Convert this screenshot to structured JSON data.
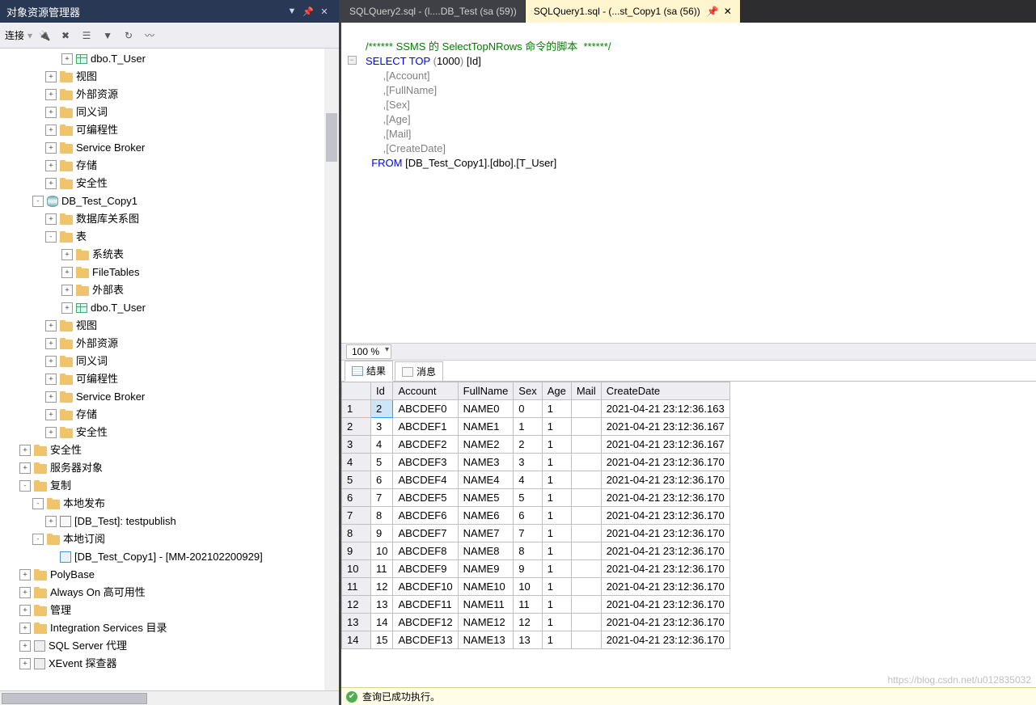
{
  "panel": {
    "title": "对象资源管理器"
  },
  "toolbar": {
    "connect_label": "连接",
    "icons": [
      "plug-icon",
      "plug-x-icon",
      "list-icon",
      "filter-icon",
      "refresh-icon",
      "activity-icon"
    ]
  },
  "tree": [
    {
      "d": 4,
      "exp": "+",
      "icon": "table",
      "label": "dbo.T_User"
    },
    {
      "d": 3,
      "exp": "+",
      "icon": "folder",
      "label": "视图"
    },
    {
      "d": 3,
      "exp": "+",
      "icon": "folder",
      "label": "外部资源"
    },
    {
      "d": 3,
      "exp": "+",
      "icon": "folder",
      "label": "同义词"
    },
    {
      "d": 3,
      "exp": "+",
      "icon": "folder",
      "label": "可编程性"
    },
    {
      "d": 3,
      "exp": "+",
      "icon": "folder",
      "label": "Service Broker"
    },
    {
      "d": 3,
      "exp": "+",
      "icon": "folder",
      "label": "存储"
    },
    {
      "d": 3,
      "exp": "+",
      "icon": "folder",
      "label": "安全性"
    },
    {
      "d": 2,
      "exp": "-",
      "icon": "db",
      "label": "DB_Test_Copy1"
    },
    {
      "d": 3,
      "exp": "+",
      "icon": "folder",
      "label": "数据库关系图"
    },
    {
      "d": 3,
      "exp": "-",
      "icon": "folder",
      "label": "表"
    },
    {
      "d": 4,
      "exp": "+",
      "icon": "folder",
      "label": "系统表"
    },
    {
      "d": 4,
      "exp": "+",
      "icon": "folder",
      "label": "FileTables"
    },
    {
      "d": 4,
      "exp": "+",
      "icon": "folder",
      "label": "外部表"
    },
    {
      "d": 4,
      "exp": "+",
      "icon": "table",
      "label": "dbo.T_User"
    },
    {
      "d": 3,
      "exp": "+",
      "icon": "folder",
      "label": "视图"
    },
    {
      "d": 3,
      "exp": "+",
      "icon": "folder",
      "label": "外部资源"
    },
    {
      "d": 3,
      "exp": "+",
      "icon": "folder",
      "label": "同义词"
    },
    {
      "d": 3,
      "exp": "+",
      "icon": "folder",
      "label": "可编程性"
    },
    {
      "d": 3,
      "exp": "+",
      "icon": "folder",
      "label": "Service Broker"
    },
    {
      "d": 3,
      "exp": "+",
      "icon": "folder",
      "label": "存储"
    },
    {
      "d": 3,
      "exp": "+",
      "icon": "folder",
      "label": "安全性"
    },
    {
      "d": 1,
      "exp": "+",
      "icon": "folder",
      "label": "安全性"
    },
    {
      "d": 1,
      "exp": "+",
      "icon": "folder",
      "label": "服务器对象"
    },
    {
      "d": 1,
      "exp": "-",
      "icon": "folder",
      "label": "复制"
    },
    {
      "d": 2,
      "exp": "-",
      "icon": "folder",
      "label": "本地发布"
    },
    {
      "d": 3,
      "exp": "+",
      "icon": "pub",
      "label": "[DB_Test]: testpublish"
    },
    {
      "d": 2,
      "exp": "-",
      "icon": "folder",
      "label": "本地订阅"
    },
    {
      "d": 3,
      "exp": "",
      "icon": "sub",
      "label": "[DB_Test_Copy1] - [MM-202102200929]"
    },
    {
      "d": 1,
      "exp": "+",
      "icon": "folder",
      "label": "PolyBase"
    },
    {
      "d": 1,
      "exp": "+",
      "icon": "folder",
      "label": "Always On 高可用性"
    },
    {
      "d": 1,
      "exp": "+",
      "icon": "folder",
      "label": "管理"
    },
    {
      "d": 1,
      "exp": "+",
      "icon": "folder",
      "label": "Integration Services 目录"
    },
    {
      "d": 1,
      "exp": "+",
      "icon": "misc",
      "label": "SQL Server 代理"
    },
    {
      "d": 1,
      "exp": "+",
      "icon": "misc",
      "label": "XEvent 探查器"
    }
  ],
  "tabs": [
    {
      "label": "SQLQuery2.sql - (l....DB_Test (sa (59))",
      "active": false
    },
    {
      "label": "SQLQuery1.sql - (...st_Copy1 (sa (56))",
      "active": true
    }
  ],
  "editor": {
    "comment": "/****** SSMS 的 SelectTopNRows 命令的脚本  ******/",
    "l1a": "SELECT",
    "l1b": " TOP ",
    "l1c": "(",
    "l1d": "1000",
    "l1e": ")",
    "l1f": " [Id]",
    "l2": "      ,[Account]",
    "l3": "      ,[FullName]",
    "l4": "      ,[Sex]",
    "l5": "      ,[Age]",
    "l6": "      ,[Mail]",
    "l7": "      ,[CreateDate]",
    "l8a": "  FROM ",
    "l8b": "[DB_Test_Copy1].[dbo].[T_User]"
  },
  "zoom": {
    "value": "100 %",
    "drop": "▾"
  },
  "result_tabs": {
    "results": "结果",
    "messages": "消息"
  },
  "columns": [
    "",
    "Id",
    "Account",
    "FullName",
    "Sex",
    "Age",
    "Mail",
    "CreateDate"
  ],
  "rows": [
    {
      "n": "1",
      "Id": "2",
      "Account": "ABCDEF0",
      "FullName": "NAME0",
      "Sex": "0",
      "Age": "1",
      "Mail": "",
      "CreateDate": "2021-04-21 23:12:36.163"
    },
    {
      "n": "2",
      "Id": "3",
      "Account": "ABCDEF1",
      "FullName": "NAME1",
      "Sex": "1",
      "Age": "1",
      "Mail": "",
      "CreateDate": "2021-04-21 23:12:36.167"
    },
    {
      "n": "3",
      "Id": "4",
      "Account": "ABCDEF2",
      "FullName": "NAME2",
      "Sex": "2",
      "Age": "1",
      "Mail": "",
      "CreateDate": "2021-04-21 23:12:36.167"
    },
    {
      "n": "4",
      "Id": "5",
      "Account": "ABCDEF3",
      "FullName": "NAME3",
      "Sex": "3",
      "Age": "1",
      "Mail": "",
      "CreateDate": "2021-04-21 23:12:36.170"
    },
    {
      "n": "5",
      "Id": "6",
      "Account": "ABCDEF4",
      "FullName": "NAME4",
      "Sex": "4",
      "Age": "1",
      "Mail": "",
      "CreateDate": "2021-04-21 23:12:36.170"
    },
    {
      "n": "6",
      "Id": "7",
      "Account": "ABCDEF5",
      "FullName": "NAME5",
      "Sex": "5",
      "Age": "1",
      "Mail": "",
      "CreateDate": "2021-04-21 23:12:36.170"
    },
    {
      "n": "7",
      "Id": "8",
      "Account": "ABCDEF6",
      "FullName": "NAME6",
      "Sex": "6",
      "Age": "1",
      "Mail": "",
      "CreateDate": "2021-04-21 23:12:36.170"
    },
    {
      "n": "8",
      "Id": "9",
      "Account": "ABCDEF7",
      "FullName": "NAME7",
      "Sex": "7",
      "Age": "1",
      "Mail": "",
      "CreateDate": "2021-04-21 23:12:36.170"
    },
    {
      "n": "9",
      "Id": "10",
      "Account": "ABCDEF8",
      "FullName": "NAME8",
      "Sex": "8",
      "Age": "1",
      "Mail": "",
      "CreateDate": "2021-04-21 23:12:36.170"
    },
    {
      "n": "10",
      "Id": "11",
      "Account": "ABCDEF9",
      "FullName": "NAME9",
      "Sex": "9",
      "Age": "1",
      "Mail": "",
      "CreateDate": "2021-04-21 23:12:36.170"
    },
    {
      "n": "11",
      "Id": "12",
      "Account": "ABCDEF10",
      "FullName": "NAME10",
      "Sex": "10",
      "Age": "1",
      "Mail": "",
      "CreateDate": "2021-04-21 23:12:36.170"
    },
    {
      "n": "12",
      "Id": "13",
      "Account": "ABCDEF11",
      "FullName": "NAME11",
      "Sex": "11",
      "Age": "1",
      "Mail": "",
      "CreateDate": "2021-04-21 23:12:36.170"
    },
    {
      "n": "13",
      "Id": "14",
      "Account": "ABCDEF12",
      "FullName": "NAME12",
      "Sex": "12",
      "Age": "1",
      "Mail": "",
      "CreateDate": "2021-04-21 23:12:36.170"
    },
    {
      "n": "14",
      "Id": "15",
      "Account": "ABCDEF13",
      "FullName": "NAME13",
      "Sex": "13",
      "Age": "1",
      "Mail": "",
      "CreateDate": "2021-04-21 23:12:36.170"
    }
  ],
  "status": {
    "text": "查询已成功执行。"
  },
  "watermark": "https://blog.csdn.net/u012835032"
}
